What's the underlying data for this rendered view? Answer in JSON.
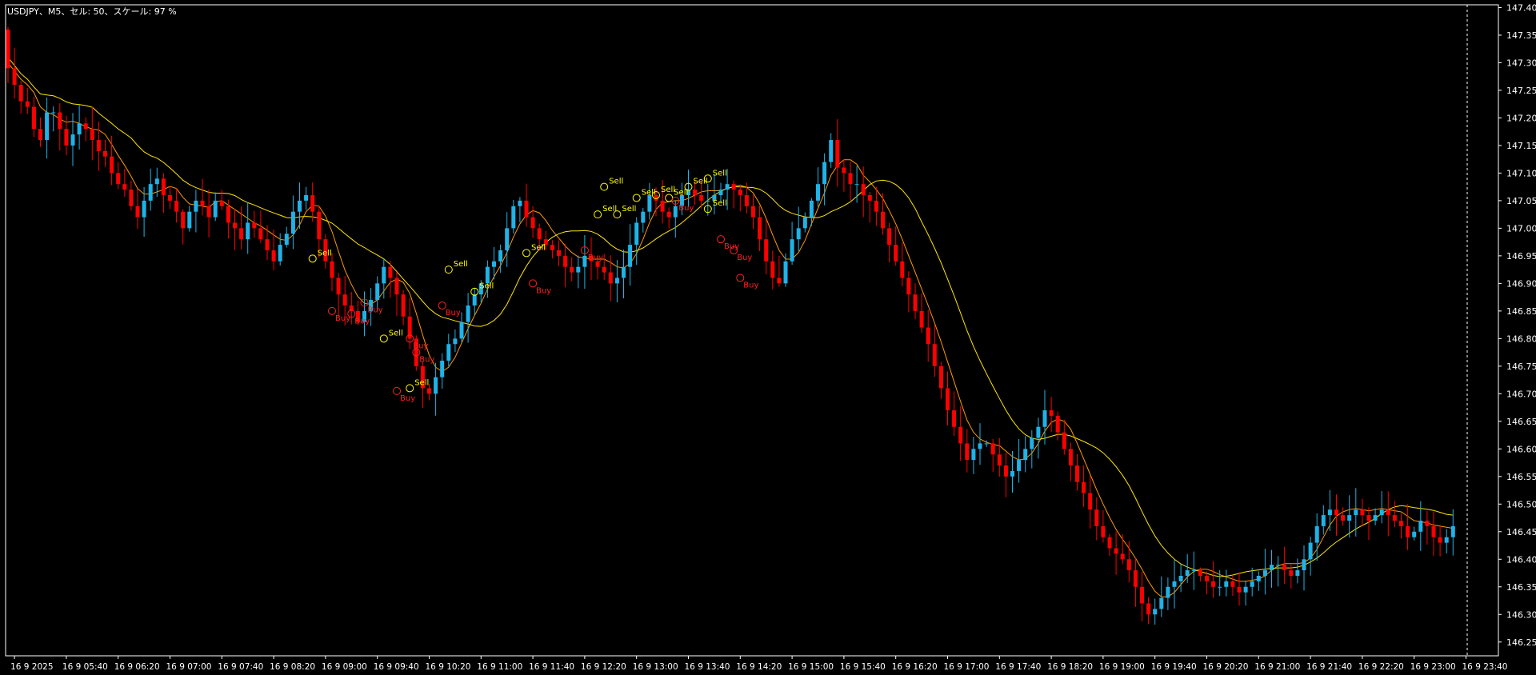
{
  "chart_data": {
    "type": "candlestick",
    "title": "USDJPY、M5、セル: 50、スケール: 97 %",
    "colors": {
      "background": "#000000",
      "frame": "#FFFFFF",
      "bull": "#1FB3E8",
      "bear": "#FF0000",
      "ma_fast": "#FF9900",
      "ma_slow": "#FFE600",
      "sell_label": "#FFFF00",
      "buy_label": "#FF2020",
      "text": "#FFFFFF"
    },
    "y_axis": {
      "min": 146.225,
      "max": 147.405,
      "ticks": [
        "147.400",
        "147.350",
        "147.300",
        "147.250",
        "147.200",
        "147.150",
        "147.100",
        "147.050",
        "147.000",
        "146.950",
        "146.900",
        "146.850",
        "146.800",
        "146.750",
        "146.700",
        "146.650",
        "146.600",
        "146.550",
        "146.500",
        "146.450",
        "146.400",
        "146.350",
        "146.300",
        "146.250"
      ]
    },
    "x_axis": {
      "labels": [
        {
          "label": "16 9 2025",
          "bar": 1
        },
        {
          "label": "16 9 05:40",
          "bar": 9
        },
        {
          "label": "16 9 06:20",
          "bar": 17
        },
        {
          "label": "16 9 07:00",
          "bar": 25
        },
        {
          "label": "16 9 07:40",
          "bar": 33
        },
        {
          "label": "16 9 08:20",
          "bar": 41
        },
        {
          "label": "16 9 09:00",
          "bar": 49
        },
        {
          "label": "16 9 09:40",
          "bar": 57
        },
        {
          "label": "16 9 10:20",
          "bar": 65
        },
        {
          "label": "16 9 11:00",
          "bar": 73
        },
        {
          "label": "16 9 11:40",
          "bar": 81
        },
        {
          "label": "16 9 12:20",
          "bar": 89
        },
        {
          "label": "16 9 13:00",
          "bar": 97
        },
        {
          "label": "16 9 13:40",
          "bar": 105
        },
        {
          "label": "16 9 14:20",
          "bar": 113
        },
        {
          "label": "16 9 15:00",
          "bar": 121
        },
        {
          "label": "16 9 15:40",
          "bar": 129
        },
        {
          "label": "16 9 16:20",
          "bar": 137
        },
        {
          "label": "16 9 17:00",
          "bar": 145
        },
        {
          "label": "16 9 17:40",
          "bar": 153
        },
        {
          "label": "16 9 18:20",
          "bar": 161
        },
        {
          "label": "16 9 19:00",
          "bar": 169
        },
        {
          "label": "16 9 19:40",
          "bar": 177
        },
        {
          "label": "16 9 20:20",
          "bar": 185
        },
        {
          "label": "16 9 21:00",
          "bar": 193
        },
        {
          "label": "16 9 21:40",
          "bar": 201
        },
        {
          "label": "16 9 22:20",
          "bar": 209
        },
        {
          "label": "16 9 23:00",
          "bar": 217
        },
        {
          "label": "16 9 23:40",
          "bar": 225
        }
      ]
    },
    "series_close": [
      147.29,
      147.26,
      147.23,
      147.22,
      147.18,
      147.16,
      147.21,
      147.21,
      147.18,
      147.15,
      147.17,
      147.19,
      147.18,
      147.16,
      147.14,
      147.13,
      147.1,
      147.08,
      147.07,
      147.04,
      147.02,
      147.05,
      147.08,
      147.09,
      147.06,
      147.05,
      147.03,
      147.0,
      147.03,
      147.05,
      147.04,
      147.02,
      147.05,
      147.04,
      147.01,
      147.0,
      146.98,
      147.01,
      147.0,
      146.98,
      146.96,
      146.94,
      146.97,
      146.99,
      147.03,
      147.05,
      147.06,
      147.03,
      146.98,
      146.94,
      146.91,
      146.88,
      146.86,
      146.85,
      146.83,
      146.85,
      146.87,
      146.9,
      146.93,
      146.91,
      146.88,
      146.84,
      146.8,
      146.75,
      146.71,
      146.7,
      146.73,
      146.76,
      146.79,
      146.8,
      146.83,
      146.86,
      146.88,
      146.9,
      146.93,
      146.94,
      146.96,
      147.0,
      147.04,
      147.05,
      147.02,
      147.0,
      146.98,
      146.97,
      146.96,
      146.95,
      146.93,
      146.92,
      146.93,
      146.95,
      146.94,
      146.93,
      146.92,
      146.9,
      146.91,
      146.93,
      146.97,
      147.01,
      147.03,
      147.06,
      147.05,
      147.03,
      147.02,
      147.04,
      147.06,
      147.07,
      147.06,
      147.05,
      147.05,
      147.06,
      147.07,
      147.08,
      147.07,
      147.06,
      147.04,
      147.02,
      146.98,
      146.94,
      146.91,
      146.9,
      146.94,
      146.98,
      147.0,
      147.02,
      147.05,
      147.08,
      147.12,
      147.16,
      147.11,
      147.1,
      147.08,
      147.08,
      147.06,
      147.05,
      147.03,
      147.0,
      146.97,
      146.94,
      146.91,
      146.88,
      146.85,
      146.82,
      146.79,
      146.75,
      146.71,
      146.67,
      146.64,
      146.61,
      146.58,
      146.6,
      146.61,
      146.61,
      146.59,
      146.57,
      146.55,
      146.56,
      146.58,
      146.6,
      146.62,
      146.64,
      146.67,
      146.66,
      146.63,
      146.6,
      146.57,
      146.54,
      146.52,
      146.49,
      146.46,
      146.44,
      146.42,
      146.41,
      146.4,
      146.38,
      146.35,
      146.32,
      146.3,
      146.31,
      146.33,
      146.35,
      146.36,
      146.37,
      146.38,
      146.38,
      146.37,
      146.36,
      146.35,
      146.35,
      146.36,
      146.35,
      146.34,
      146.35,
      146.36,
      146.37,
      146.38,
      146.39,
      146.39,
      146.38,
      146.37,
      146.38,
      146.4,
      146.43,
      146.46,
      146.48,
      146.49,
      146.48,
      146.47,
      146.48,
      146.49,
      146.48,
      146.47,
      146.48,
      146.49,
      146.48,
      146.47,
      146.46,
      146.44,
      146.45,
      146.47,
      146.46,
      146.44,
      146.43,
      146.44,
      146.46
    ],
    "signals": [
      {
        "type": "Sell",
        "bar": 47,
        "price": 146.945
      },
      {
        "type": "Buy",
        "bar": 50,
        "price": 146.85
      },
      {
        "type": "Buy",
        "bar": 53,
        "price": 146.845
      },
      {
        "type": "Buy",
        "bar": 55,
        "price": 146.865
      },
      {
        "type": "Sell",
        "bar": 58,
        "price": 146.8
      },
      {
        "type": "Buy",
        "bar": 62,
        "price": 146.8
      },
      {
        "type": "Buy",
        "bar": 63,
        "price": 146.775
      },
      {
        "type": "Buy",
        "bar": 60,
        "price": 146.705
      },
      {
        "type": "Sell",
        "bar": 62,
        "price": 146.71
      },
      {
        "type": "Sell",
        "bar": 68,
        "price": 146.925
      },
      {
        "type": "Buy",
        "bar": 67,
        "price": 146.86
      },
      {
        "type": "Sell",
        "bar": 72,
        "price": 146.885
      },
      {
        "type": "Sell",
        "bar": 80,
        "price": 146.955
      },
      {
        "type": "Buy",
        "bar": 81,
        "price": 146.9
      },
      {
        "type": "Buy",
        "bar": 89,
        "price": 146.96
      },
      {
        "type": "Sell",
        "bar": 92,
        "price": 147.075
      },
      {
        "type": "Sell",
        "bar": 91,
        "price": 147.025
      },
      {
        "type": "Sell",
        "bar": 94,
        "price": 147.025
      },
      {
        "type": "Sell",
        "bar": 97,
        "price": 147.055
      },
      {
        "type": "Sell",
        "bar": 100,
        "price": 147.06
      },
      {
        "type": "Sell",
        "bar": 102,
        "price": 147.055
      },
      {
        "type": "Sell",
        "bar": 105,
        "price": 147.075
      },
      {
        "type": "Sell",
        "bar": 108,
        "price": 147.09
      },
      {
        "type": "Sell",
        "bar": 108,
        "price": 147.035
      },
      {
        "type": "Buy",
        "bar": 103,
        "price": 147.05
      },
      {
        "type": "Buy",
        "bar": 110,
        "price": 146.98
      },
      {
        "type": "Buy",
        "bar": 112,
        "price": 146.96
      },
      {
        "type": "Buy",
        "bar": 113,
        "price": 146.91
      }
    ]
  }
}
